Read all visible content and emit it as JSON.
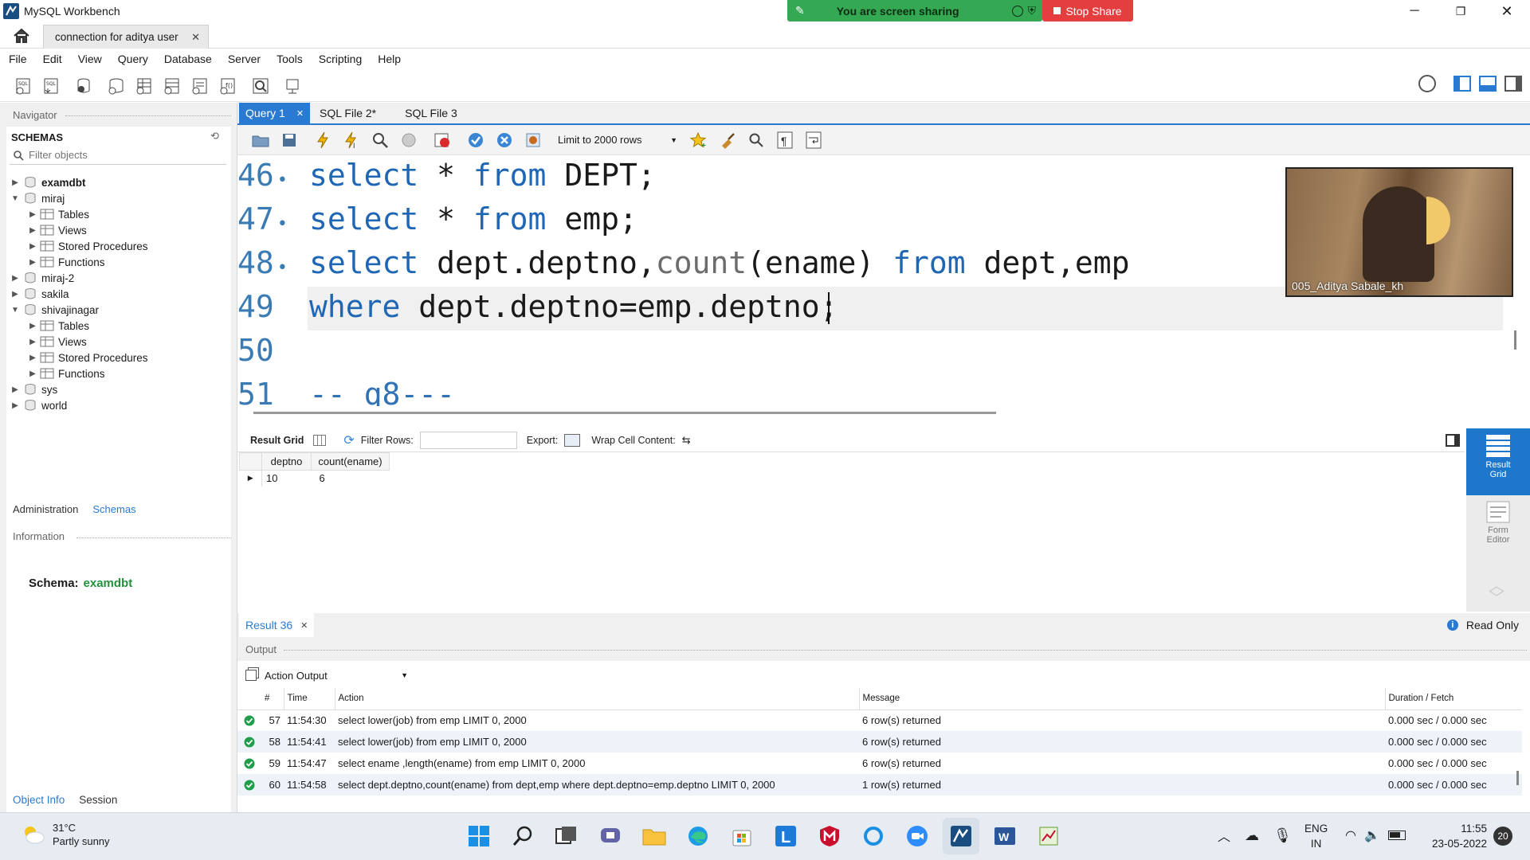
{
  "window": {
    "title": "MySQL Workbench"
  },
  "screen_share": {
    "banner_text": "You are screen sharing",
    "stop_label": "Stop Share"
  },
  "connection_tab": {
    "label": "connection for aditya user"
  },
  "menu": [
    "File",
    "Edit",
    "View",
    "Query",
    "Database",
    "Server",
    "Tools",
    "Scripting",
    "Help"
  ],
  "navigator": {
    "header": "Navigator",
    "schemas_title": "SCHEMAS",
    "filter_placeholder": "Filter objects",
    "tree": [
      {
        "label": "examdbt",
        "bold": true,
        "expanded": false
      },
      {
        "label": "miraj",
        "expanded": true,
        "children": [
          "Tables",
          "Views",
          "Stored Procedures",
          "Functions"
        ]
      },
      {
        "label": "miraj-2",
        "expanded": false
      },
      {
        "label": "sakila",
        "expanded": false
      },
      {
        "label": "shivajinagar",
        "expanded": true,
        "children": [
          "Tables",
          "Views",
          "Stored Procedures",
          "Functions"
        ]
      },
      {
        "label": "sys",
        "expanded": false
      },
      {
        "label": "world",
        "expanded": false
      }
    ],
    "bottom_tabs": [
      "Administration",
      "Schemas"
    ],
    "info_header": "Information",
    "schema_label": "Schema:",
    "schema_value": "examdbt",
    "footer_tabs": [
      "Object Info",
      "Session"
    ]
  },
  "editor": {
    "tabs": [
      "Query 1",
      "SQL File 2*",
      "SQL File 3"
    ],
    "limit_label": "Limit to 2000 rows",
    "lines": [
      {
        "num": "46",
        "marker": "•",
        "parts": [
          [
            "kw",
            "select"
          ],
          [
            "tx",
            " * "
          ],
          [
            "kw",
            "from"
          ],
          [
            "tx",
            " DEPT;"
          ]
        ]
      },
      {
        "num": "47",
        "marker": "•",
        "parts": [
          [
            "kw",
            "select"
          ],
          [
            "tx",
            " * "
          ],
          [
            "kw",
            "from"
          ],
          [
            "tx",
            " emp;"
          ]
        ]
      },
      {
        "num": "48",
        "marker": "•",
        "parts": [
          [
            "kw",
            "select"
          ],
          [
            "tx",
            " dept.deptno,"
          ],
          [
            "fn",
            "count"
          ],
          [
            "tx",
            "(ename) "
          ],
          [
            "kw",
            "from"
          ],
          [
            "tx",
            " dept,emp"
          ]
        ]
      },
      {
        "num": "49",
        "marker": "",
        "parts": [
          [
            "kw",
            "where"
          ],
          [
            "tx",
            " dept.deptno=emp.deptno;"
          ]
        ]
      },
      {
        "num": "50",
        "marker": "",
        "parts": []
      },
      {
        "num": "51",
        "marker": "",
        "parts": [
          [
            "cm",
            "-- q8---"
          ]
        ]
      }
    ]
  },
  "video": {
    "participant": "005_Aditya Sabale_kh"
  },
  "result": {
    "grid_label": "Result Grid",
    "filter_label": "Filter Rows:",
    "export_label": "Export:",
    "wrap_label": "Wrap Cell Content:",
    "columns": [
      "deptno",
      "count(ename)"
    ],
    "rows": [
      [
        "10",
        "6"
      ]
    ],
    "side_buttons": [
      "Result Grid",
      "Form Editor"
    ],
    "tab_label": "Result 36",
    "readonly_label": "Read Only"
  },
  "output": {
    "header": "Output",
    "dropdown": "Action Output",
    "columns": [
      "#",
      "Time",
      "Action",
      "Message",
      "Duration / Fetch"
    ],
    "rows": [
      {
        "n": "57",
        "time": "11:54:30",
        "action": "select lower(job) from emp LIMIT 0, 2000",
        "message": "6 row(s) returned",
        "duration": "0.000 sec / 0.000 sec"
      },
      {
        "n": "58",
        "time": "11:54:41",
        "action": "select lower(job) from emp LIMIT 0, 2000",
        "message": "6 row(s) returned",
        "duration": "0.000 sec / 0.000 sec"
      },
      {
        "n": "59",
        "time": "11:54:47",
        "action": "select ename ,length(ename) from emp LIMIT 0, 2000",
        "message": "6 row(s) returned",
        "duration": "0.000 sec / 0.000 sec"
      },
      {
        "n": "60",
        "time": "11:54:58",
        "action": "select dept.deptno,count(ename) from dept,emp  where dept.deptno=emp.deptno LIMIT 0, 2000",
        "message": "1 row(s) returned",
        "duration": "0.000 sec / 0.000 sec"
      }
    ]
  },
  "taskbar": {
    "weather_temp": "31°C",
    "weather_desc": "Partly sunny",
    "lang_1": "ENG",
    "lang_2": "IN",
    "time": "11:55",
    "date": "23-05-2022",
    "notif_count": "20"
  },
  "colors": {
    "accent": "#2a7ad1",
    "keyword": "#1f66b5",
    "success": "#1e9e4a",
    "stop": "#e03b3b",
    "banner": "#2ea043"
  }
}
